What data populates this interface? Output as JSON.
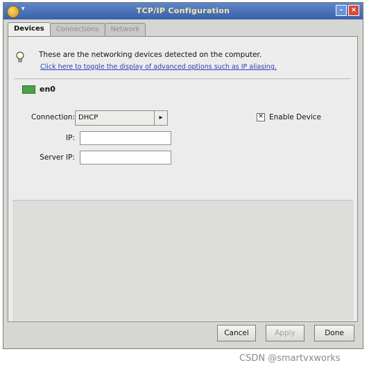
{
  "window": {
    "title": "TCP/IP Configuration"
  },
  "tabs": [
    {
      "label": "Devices",
      "active": true
    },
    {
      "label": "Connections",
      "active": false
    },
    {
      "label": "Network",
      "active": false
    }
  ],
  "info": {
    "text": "These are the networking devices detected on the computer.",
    "link": "Click here to toggle the display of advanced options such as IP aliasing."
  },
  "device": {
    "name": "en0",
    "connection_label": "Connection:",
    "connection_value": "DHCP",
    "ip_label": "IP:",
    "ip_value": "",
    "server_ip_label": "Server IP:",
    "server_ip_value": "",
    "enable_label": "Enable Device",
    "enabled": true
  },
  "buttons": {
    "cancel": "Cancel",
    "apply": "Apply",
    "done": "Done"
  },
  "credit": "CSDN @smartvxworks"
}
